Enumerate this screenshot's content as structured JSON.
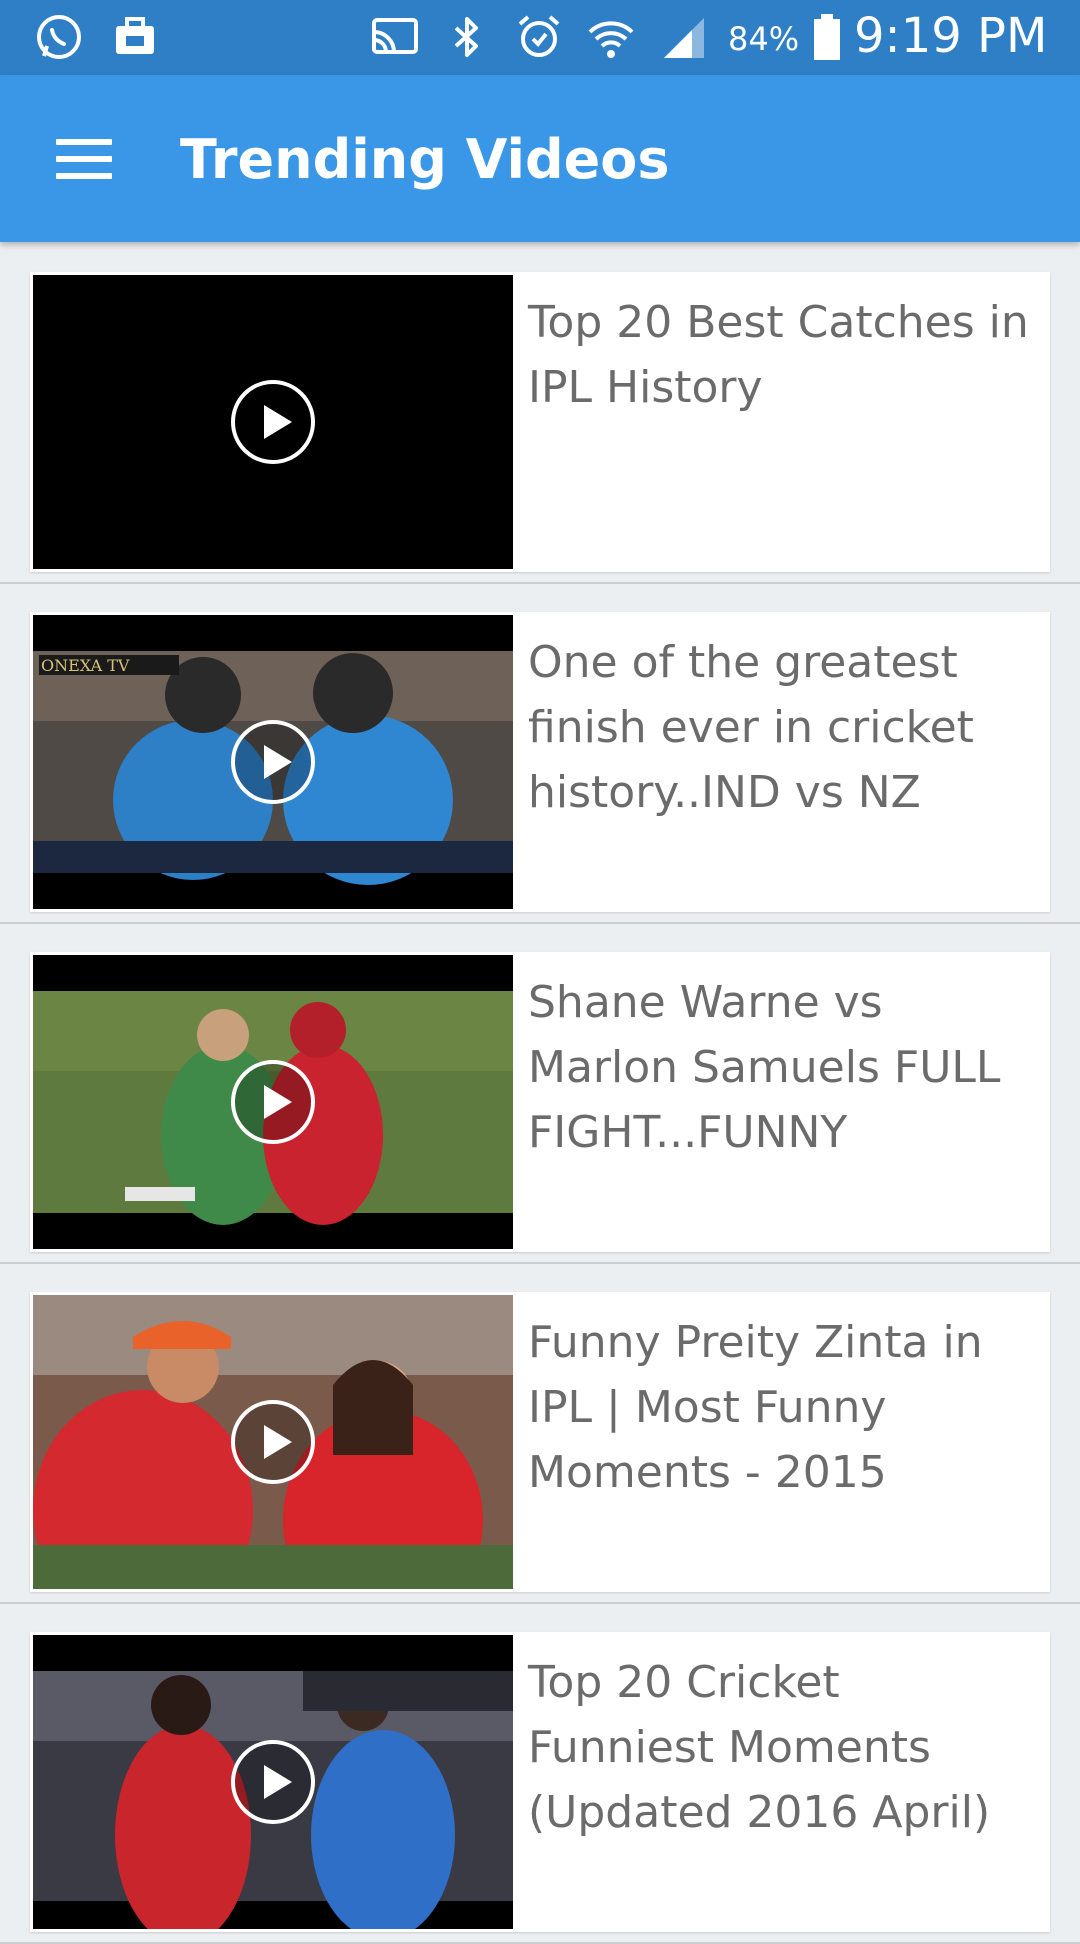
{
  "status_bar": {
    "battery": "84%",
    "time": "9:19 PM",
    "icons": [
      "whatsapp-icon",
      "briefcase-icon",
      "cast-icon",
      "bluetooth-icon",
      "alarm-icon",
      "wifi-icon",
      "signal-icon",
      "battery-icon"
    ]
  },
  "app_bar": {
    "title": "Trending Videos",
    "menu_icon": "hamburger-menu-icon"
  },
  "videos": [
    {
      "title": "Top 20 Best Catches in IPL History",
      "thumbnail": "black-frame"
    },
    {
      "title": "One of the greatest finish ever in cricket history..IND vs NZ",
      "thumbnail": "cricket-players-blue"
    },
    {
      "title": "Shane Warne vs Marlon Samuels FULL FIGHT...FUNNY",
      "thumbnail": "cricket-field-green"
    },
    {
      "title": "Funny Preity Zinta in IPL | Most Funny Moments - 2015",
      "thumbnail": "players-red-jerseys"
    },
    {
      "title": "Top 20 Cricket Funniest Moments (Updated 2016 April)",
      "thumbnail": "players-red-blue"
    }
  ],
  "colors": {
    "status_bar": "#2f7fc6",
    "app_bar": "#3a97e7",
    "background": "#eceff1",
    "card": "#ffffff",
    "title_text": "#6b6b6b"
  }
}
